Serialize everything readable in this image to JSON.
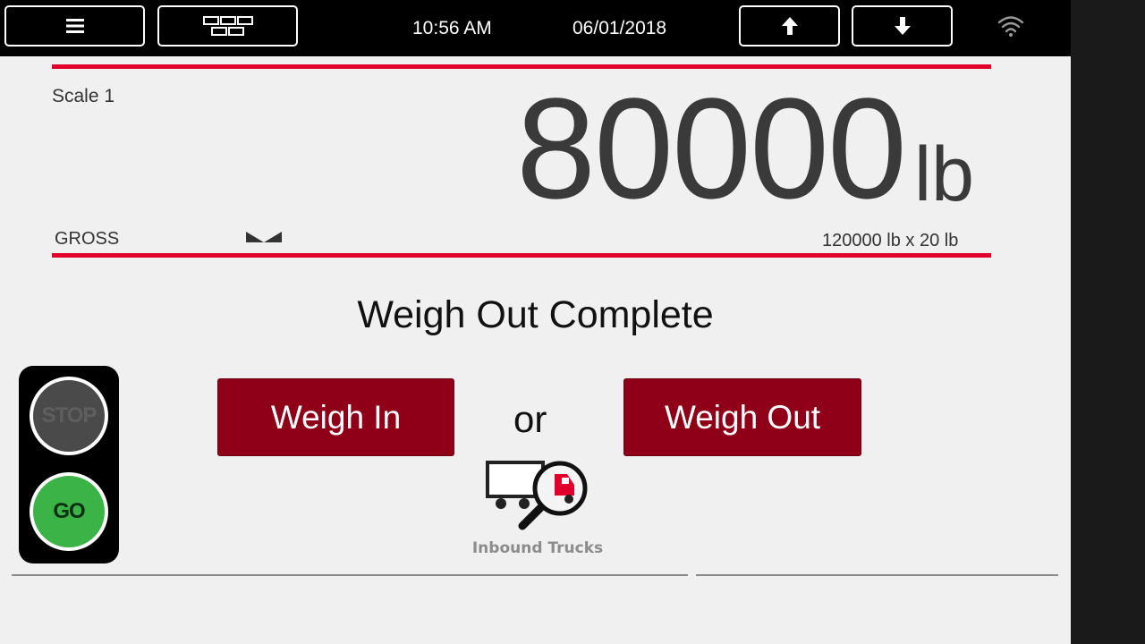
{
  "topbar": {
    "time": "10:56 AM",
    "date": "06/01/2018"
  },
  "icons": {
    "menu": "menu-icon",
    "apps": "apps-grid-icon",
    "up": "arrow-up-icon",
    "down": "arrow-down-icon",
    "wifi": "wifi-icon",
    "zero": "center-of-zero-icon",
    "truck": "truck-search-icon"
  },
  "scale": {
    "name": "Scale 1",
    "weight": "80000",
    "unit": "lb",
    "mode": "GROSS",
    "capacity": "120000 lb x 20 lb"
  },
  "status": "Weigh Out Complete",
  "actions": {
    "weigh_in": "Weigh In",
    "or": "or",
    "weigh_out": "Weigh Out"
  },
  "inbound": {
    "label": "Inbound Trucks"
  },
  "traffic_light": {
    "stop": "STOP",
    "go": "GO"
  },
  "colors": {
    "accent_red": "#e0002b",
    "button_red": "#8f0018",
    "go_green": "#3cb346",
    "stop_gray": "#4a4a4a",
    "screen_bg": "#f1f0f0"
  }
}
